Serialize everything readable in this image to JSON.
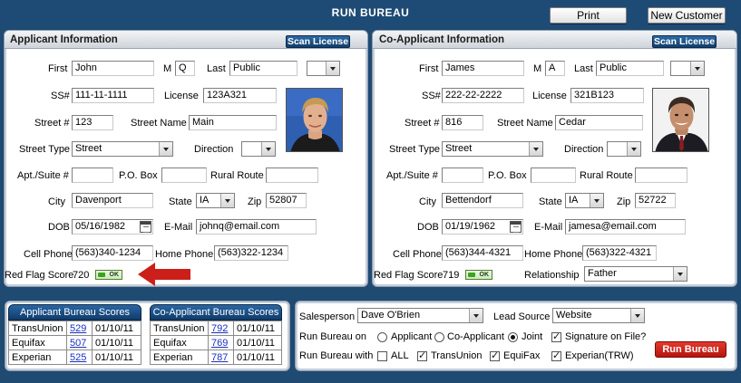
{
  "app": {
    "title": "RUN BUREAU",
    "print_label": "Print",
    "new_customer_label": "New Customer"
  },
  "labels": {
    "first": "First",
    "mi": "M",
    "last": "Last",
    "ssn": "SS#",
    "license": "License",
    "street_num": "Street #",
    "street_name": "Street Name",
    "street_type": "Street Type",
    "direction": "Direction",
    "apt": "Apt./Suite #",
    "po_box": "P.O. Box",
    "rural_route": "Rural Route",
    "city": "City",
    "state": "State",
    "zip": "Zip",
    "dob": "DOB",
    "email": "E-Mail",
    "cell_phone": "Cell Phone",
    "home_phone": "Home Phone",
    "red_flag": "Red Flag Score",
    "relationship": "Relationship",
    "scan_license": "Scan License",
    "ok_badge": "OK"
  },
  "applicant": {
    "header": "Applicant Information",
    "first": "John",
    "mi": "Q",
    "last": "Public",
    "suffix": "",
    "ssn": "111-11-1111",
    "license": "123A321",
    "street_num": "123",
    "street_name": "Main",
    "street_type": "Street",
    "direction": "",
    "apt": "",
    "po_box": "",
    "rural_route": "",
    "city": "Davenport",
    "state": "IA",
    "zip": "52807",
    "dob": "05/16/1982",
    "email": "johnq@email.com",
    "cell_phone": "(563)340-1234",
    "home_phone": "(563)322-1234",
    "red_flag_score": "720"
  },
  "coapplicant": {
    "header": "Co-Applicant Information",
    "first": "James",
    "mi": "A",
    "last": "Public",
    "suffix": "",
    "ssn": "222-22-2222",
    "license": "321B123",
    "street_num": "816",
    "street_name": "Cedar",
    "street_type": "Street",
    "direction": "",
    "apt": "",
    "po_box": "",
    "rural_route": "",
    "city": "Bettendorf",
    "state": "IA",
    "zip": "52722",
    "dob": "01/19/1962",
    "email": "jamesa@email.com",
    "cell_phone": "(563)344-4321",
    "home_phone": "(563)322-4321",
    "red_flag_score": "719",
    "relationship": "Father"
  },
  "applicant_scores": {
    "header": "Applicant Bureau Scores",
    "rows": [
      {
        "bureau": "TransUnion",
        "score": "529",
        "date": "01/10/11"
      },
      {
        "bureau": "Equifax",
        "score": "507",
        "date": "01/10/11"
      },
      {
        "bureau": "Experian",
        "score": "525",
        "date": "01/10/11"
      }
    ]
  },
  "coapplicant_scores": {
    "header": "Co-Applicant Bureau Scores",
    "rows": [
      {
        "bureau": "TransUnion",
        "score": "792",
        "date": "01/10/11"
      },
      {
        "bureau": "Equifax",
        "score": "769",
        "date": "01/10/11"
      },
      {
        "bureau": "Experian",
        "score": "787",
        "date": "01/10/11"
      }
    ]
  },
  "bureau": {
    "salesperson_label": "Salesperson",
    "salesperson": "Dave O'Brien",
    "lead_source_label": "Lead Source",
    "lead_source": "Website",
    "run_on_label": "Run Bureau on",
    "run_on_options": {
      "applicant": "Applicant",
      "coapplicant": "Co-Applicant",
      "joint": "Joint"
    },
    "run_on_selected": "joint",
    "signature_label": "Signature on File?",
    "signature_checked": true,
    "run_with_label": "Run Bureau with",
    "with": {
      "all": "ALL",
      "transunion": "TransUnion",
      "equifax": "EquiFax",
      "experian": "Experian(TRW)"
    },
    "with_checked": {
      "all": false,
      "transunion": true,
      "equifax": true,
      "experian": true
    },
    "run_button": "Run Bureau"
  },
  "colors": {
    "background": "#1f4a72",
    "accent": "#1b4b7e",
    "run_button": "#c9231a",
    "arrow": "#cc1f1a"
  }
}
